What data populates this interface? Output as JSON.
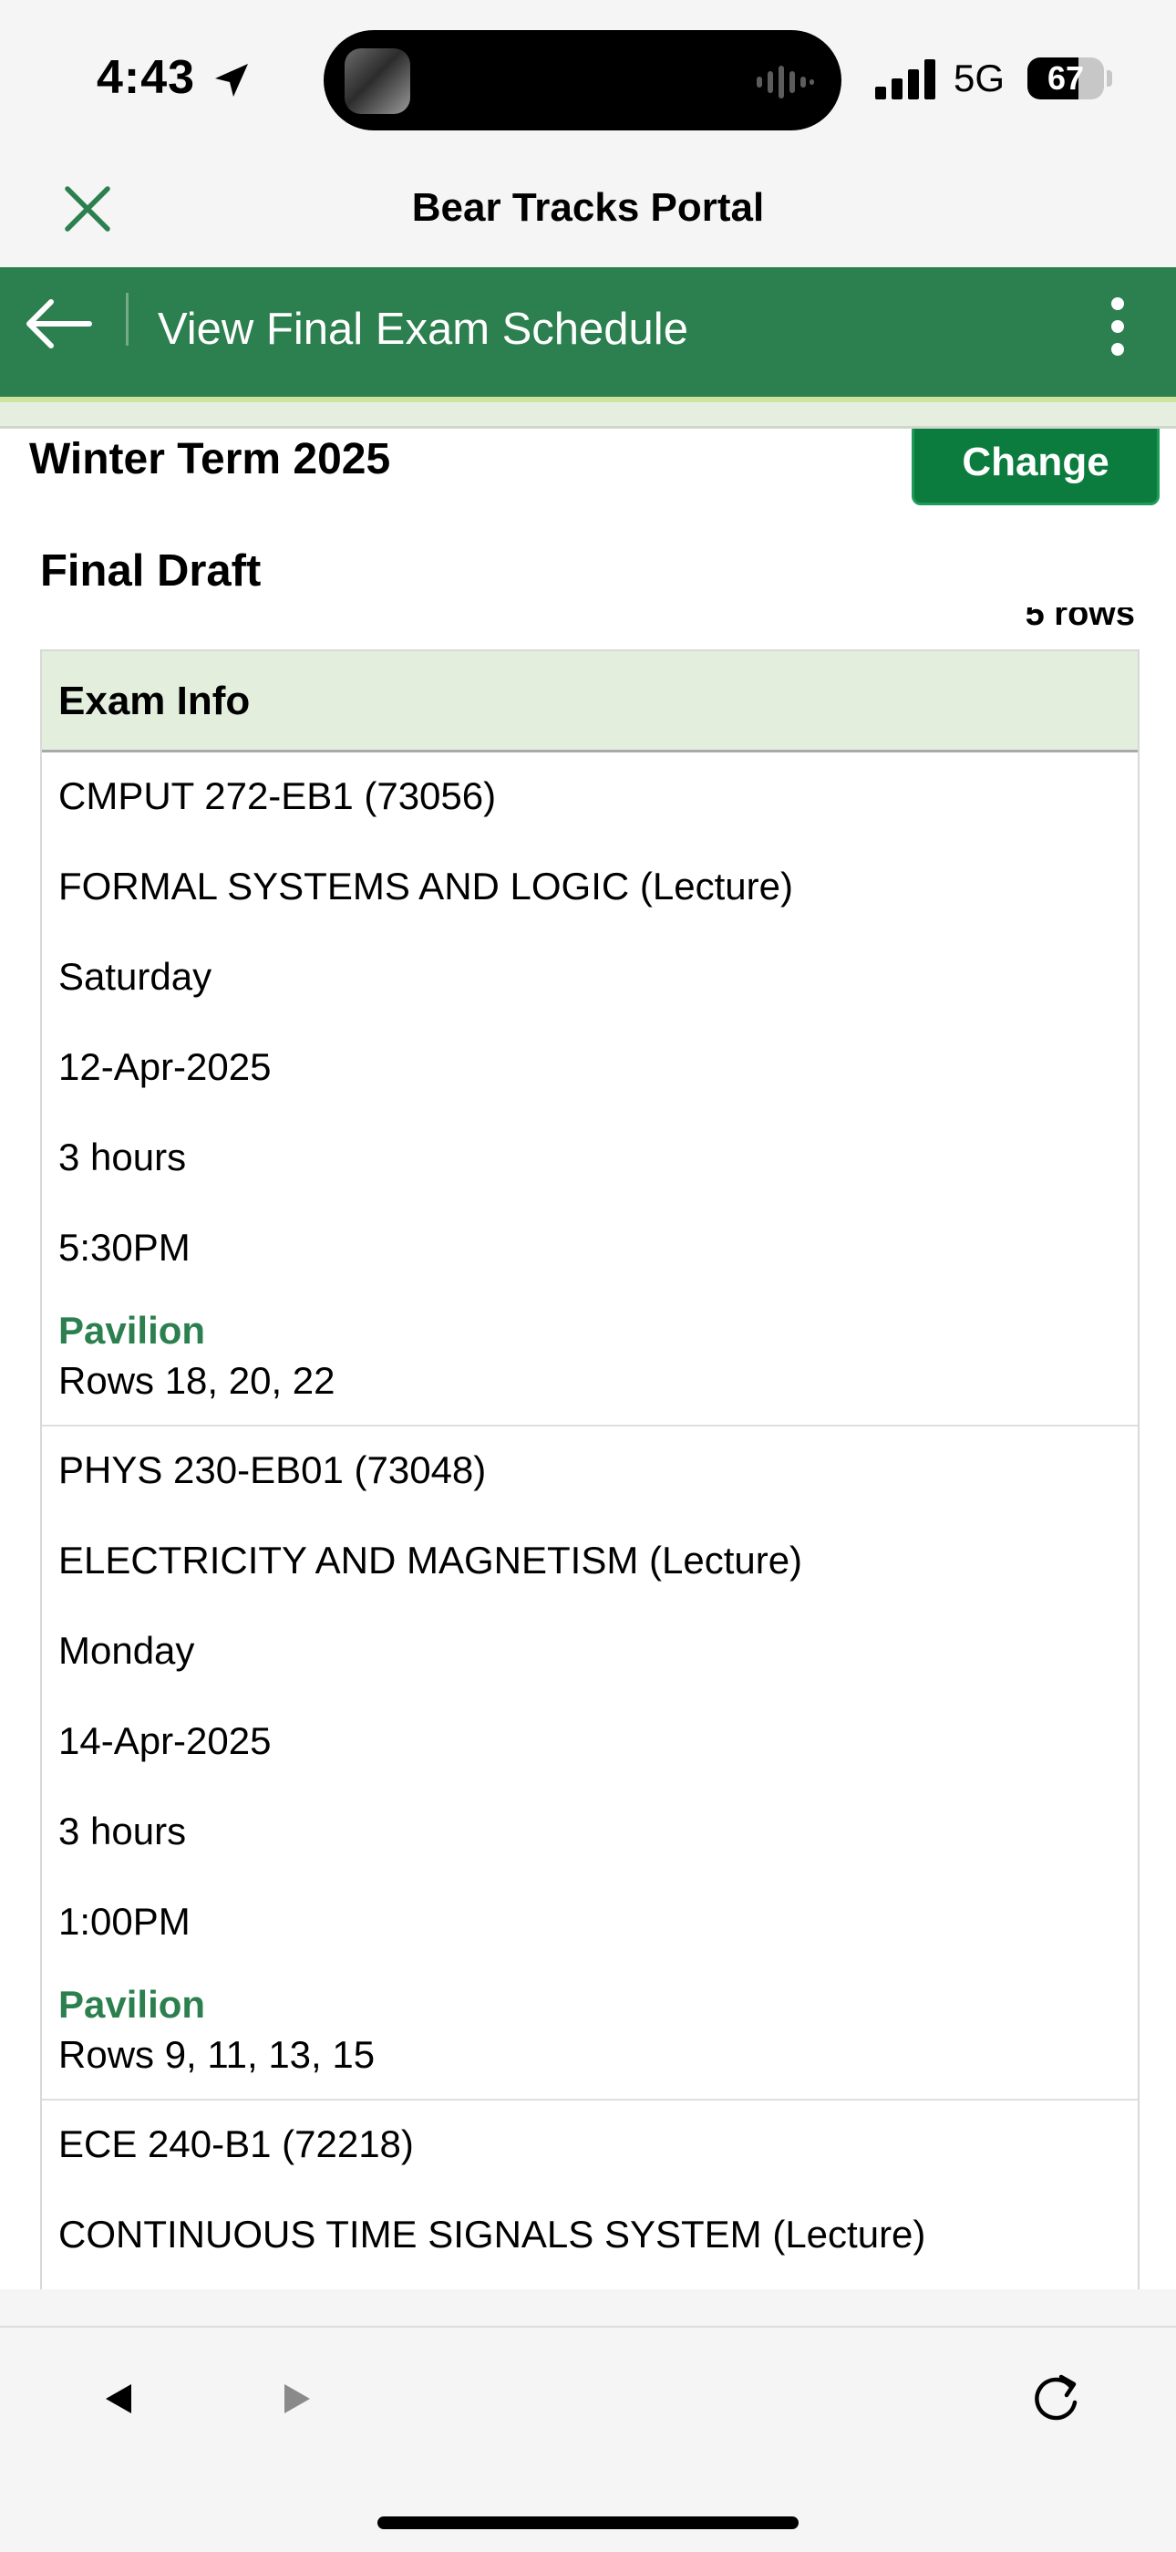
{
  "status_bar": {
    "time": "4:43",
    "network": "5G",
    "battery": "67",
    "battery_level": 0.67
  },
  "title_bar": {
    "title": "Bear Tracks Portal"
  },
  "header": {
    "title": "View Final Exam Schedule"
  },
  "term": {
    "label": "Winter Term 2025",
    "change_label": "Change"
  },
  "schedule": {
    "title": "Final Draft",
    "row_count": "5 rows",
    "column_header": "Exam Info",
    "exams": [
      {
        "course": "CMPUT 272-EB1 (73056)",
        "name": "FORMAL SYSTEMS AND LOGIC (Lecture)",
        "day": "Saturday",
        "date": "12-Apr-2025",
        "duration": "3 hours",
        "time": "5:30PM",
        "location": "Pavilion",
        "rows": "Rows 18, 20, 22"
      },
      {
        "course": "PHYS 230-EB01 (73048)",
        "name": "ELECTRICITY AND MAGNETISM (Lecture)",
        "day": "Monday",
        "date": "14-Apr-2025",
        "duration": "3 hours",
        "time": "1:00PM",
        "location": "Pavilion",
        "rows": "Rows 9, 11, 13, 15"
      },
      {
        "course": "ECE 240-B1 (72218)",
        "name": "CONTINUOUS TIME SIGNALS SYSTEM (Lecture)"
      }
    ]
  },
  "colors": {
    "brand_green": "#2c7f4e",
    "button_green": "#0b7b3e",
    "header_row_bg": "#e3eedd"
  }
}
